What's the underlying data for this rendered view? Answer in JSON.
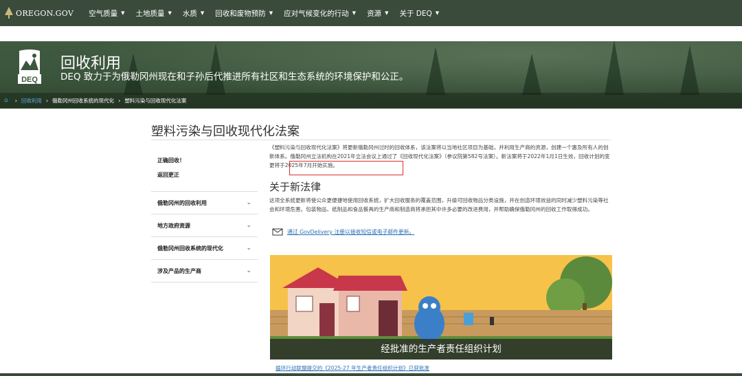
{
  "nav": {
    "logo_text": "OREGON.GOV",
    "items": [
      {
        "label": "空气质量"
      },
      {
        "label": "土地质量"
      },
      {
        "label": "水质"
      },
      {
        "label": "回收和废物预防"
      },
      {
        "label": "应对气候变化的行动"
      },
      {
        "label": "资源"
      },
      {
        "label": "关于 DEQ"
      }
    ]
  },
  "hero": {
    "logo_text": "DEQ",
    "title": "回收利用",
    "subtitle": "DEQ 致力于为俄勒冈州现在和子孙后代推进所有社区和生态系统的环境保护和公正。"
  },
  "breadcrumb": {
    "items": [
      "回收利用",
      "俄勒冈州回收系统的现代化",
      "塑料污染与回收现代化法案"
    ]
  },
  "page": {
    "title": "塑料污染与回收现代化法案"
  },
  "sidebar": {
    "top_links": [
      "正确回收！",
      "返回更正"
    ],
    "items": [
      {
        "label": "俄勒冈州的回收利用"
      },
      {
        "label": "地方政府资源"
      },
      {
        "label": "俄勒冈州回收系统的现代化"
      },
      {
        "label": "涉及产品的生产商"
      }
    ]
  },
  "main": {
    "intro": "《塑料污染与回收现代化法案》将更新俄勒冈州过时的回收体系，该法案将以当地社区项目为基础，并利用生产商的资源，创建一个惠及所有人的创新体系。俄勒冈州立法机构在2021年立法会议上通过了《回收现代化法案》（参议院第582号法案）。新法案将于2022年1月1日生效，回收计划的变更将于2025年7月开始实施。",
    "section_heading": "关于新法律",
    "section_text": "这项全系统更新将使公众更便捷地使用回收系统，扩大回收服务的覆盖范围，升级可回收物品分类设施，并在创造环境效益的同时减少塑料污染等社会和环境危害。包装物品、纸制品和食品餐具的生产商和制造商将承担其中许多必要的改进费用，并帮助确保俄勒冈州的回收工作取得成功。",
    "subscribe_text": "通过 GovDelivery 注册以接收短信或电子邮件更新。",
    "banner_caption": "经批准的生产者责任组织计划",
    "bottom_link": "循环行动联盟提交的《2025-27 年生产者责任组织计划》已获批准"
  }
}
